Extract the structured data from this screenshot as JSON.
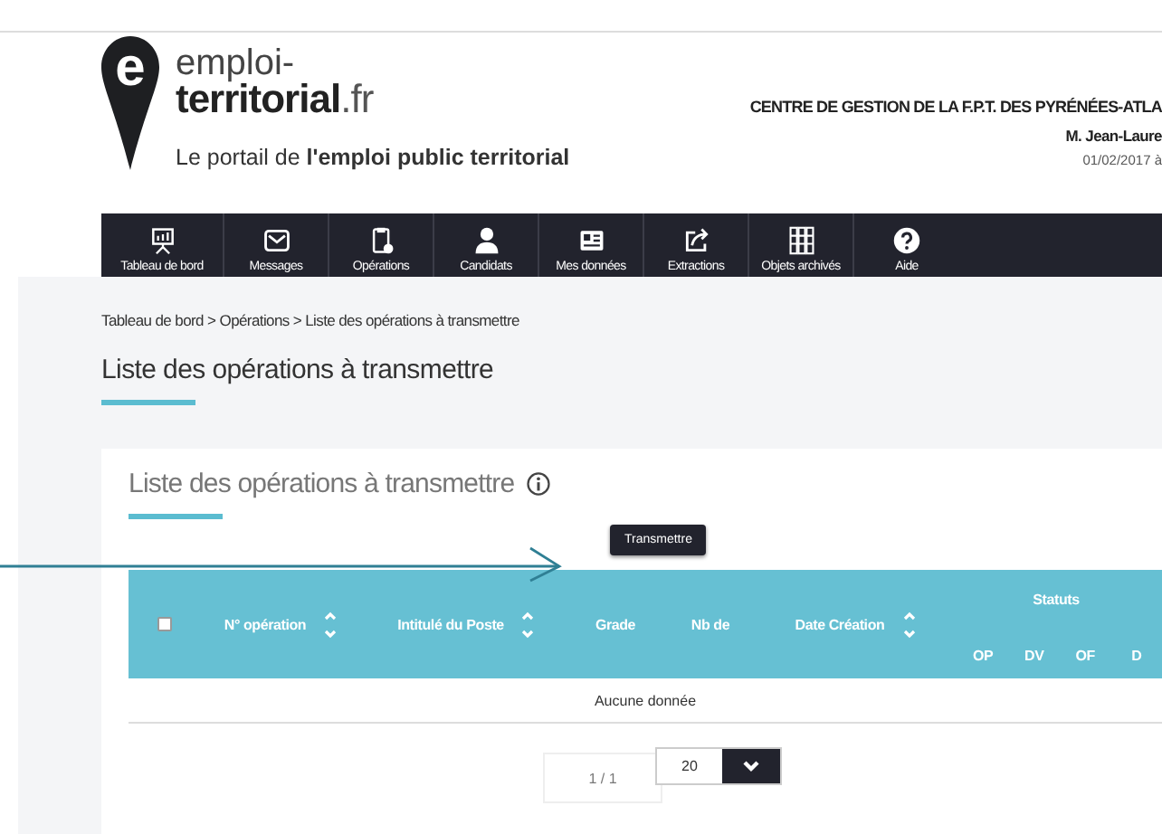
{
  "header": {
    "logo": {
      "letter": "e",
      "line1": "emploi-",
      "line2": "territorial",
      "suffix": ".fr"
    },
    "tagline": "Le portail de **l'emploi public territorial**",
    "organization": "CENTRE DE GESTION DE LA F.P.T. DES PYRÉNÉES-ATLA",
    "user": "M. Jean-Laure",
    "date": "01/02/2017 à"
  },
  "nav": [
    {
      "label": "Tableau de bord"
    },
    {
      "label": "Messages"
    },
    {
      "label": "Opérations"
    },
    {
      "label": "Candidats"
    },
    {
      "label": "Mes données"
    },
    {
      "label": "Extractions"
    },
    {
      "label": "Objets archivés"
    },
    {
      "label": "Aide"
    }
  ],
  "breadcrumb": "Tableau de bord > Opérations > Liste des opérations à transmettre",
  "page_title": "Liste des opérations à transmettre",
  "card": {
    "title": "Liste des opérations à transmettre",
    "button": "Transmettre",
    "table": {
      "select_all_checked": false,
      "columns": [
        {
          "label": "N° opération",
          "sortable": true
        },
        {
          "label": "Intitulé du Poste",
          "sortable": true
        },
        {
          "label": "Grade",
          "sortable": false
        },
        {
          "label": "Nb de",
          "sortable": false
        },
        {
          "label": "Date Création",
          "sortable": true
        }
      ],
      "group": {
        "label": "Statuts",
        "columns": [
          "OP",
          "DV",
          "OF",
          "D"
        ]
      },
      "empty_message": "Aucune donnée"
    },
    "pagination": {
      "page": "1 / 1",
      "page_size": "20"
    }
  }
}
